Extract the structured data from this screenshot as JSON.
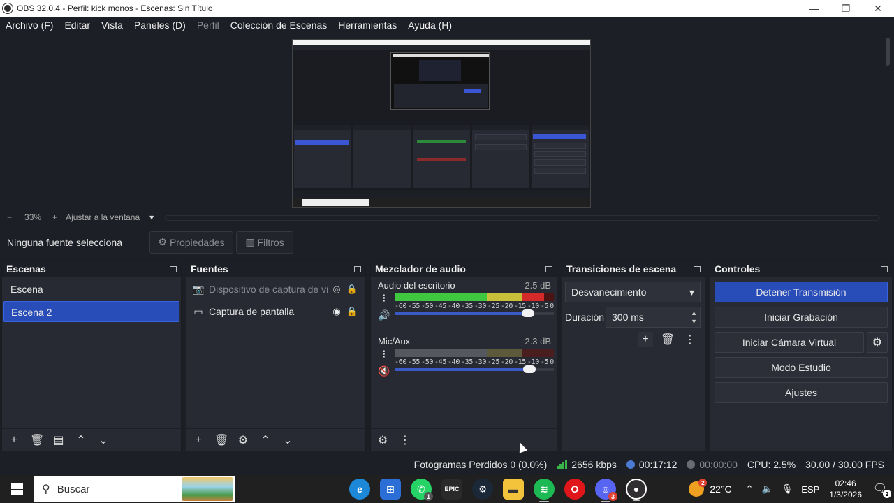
{
  "window": {
    "title": "OBS 32.0.4 - Perfil: kick monos - Escenas: Sin Título",
    "minimize": "—",
    "restore": "❐",
    "close": "✕"
  },
  "menu": [
    {
      "label": "Archivo (F)",
      "enabled": true
    },
    {
      "label": "Editar",
      "enabled": true
    },
    {
      "label": "Vista",
      "enabled": true
    },
    {
      "label": "Paneles (D)",
      "enabled": true
    },
    {
      "label": "Perfil",
      "enabled": false
    },
    {
      "label": "Colección de Escenas",
      "enabled": true
    },
    {
      "label": "Herramientas",
      "enabled": true
    },
    {
      "label": "Ayuda (H)",
      "enabled": true
    }
  ],
  "zoom": {
    "minus": "−",
    "value": "33%",
    "plus": "+",
    "fit_label": "Ajustar a la ventana",
    "dropdown": "▾"
  },
  "context": {
    "no_source": "Ninguna fuente selecciona",
    "properties": "Propiedades",
    "filters": "Filtros"
  },
  "scenes": {
    "title": "Escenas",
    "items": [
      {
        "label": "Escena",
        "selected": false
      },
      {
        "label": "Escena 2",
        "selected": true
      }
    ]
  },
  "sources": {
    "title": "Fuentes",
    "items": [
      {
        "label": "Dispositivo de captura de vi",
        "icon": "camera-icon",
        "visible": false,
        "locked": true
      },
      {
        "label": "Captura de pantalla",
        "icon": "monitor-icon",
        "visible": true,
        "locked": true
      }
    ]
  },
  "mixer": {
    "title": "Mezclador de audio",
    "ticks": [
      "-60",
      "-55",
      "-50",
      "-45",
      "-40",
      "-35",
      "-30",
      "-25",
      "-20",
      "-15",
      "-10",
      "-5",
      "0"
    ],
    "channels": [
      {
        "name": "Audio del escritorio",
        "db": "-2.5 dB",
        "muted": false,
        "volume_fraction": 0.9
      },
      {
        "name": "Mic/Aux",
        "db": "-2.3 dB",
        "muted": true,
        "volume_fraction": 0.91
      }
    ]
  },
  "transitions": {
    "title": "Transiciones de escena",
    "selected": "Desvanecimiento",
    "duration_label": "Duración",
    "duration_value": "300 ms"
  },
  "controls": {
    "title": "Controles",
    "stop_stream": "Detener Transmisión",
    "start_recording": "Iniciar Grabación",
    "start_virtual_cam": "Iniciar Cámara Virtual",
    "studio_mode": "Modo Estudio",
    "settings": "Ajustes"
  },
  "status": {
    "dropped_frames": "Fotogramas Perdidos 0 (0.0%)",
    "bitrate": "2656 kbps",
    "stream_time": "00:17:12",
    "record_time": "00:00:00",
    "cpu": "CPU: 2.5%",
    "fps": "30.00 / 30.00 FPS"
  },
  "taskbar": {
    "search_placeholder": "Buscar",
    "temperature": "22°C",
    "weather_badge": "2",
    "language": "ESP",
    "time": "02:46",
    "date": "1/3/2026",
    "notification_count": "2",
    "whatsapp_badge": "1",
    "discord_badge": "3",
    "epic_label": "EPIC",
    "colors": {
      "edge": "#1e88d8",
      "store": "#2b6fd6",
      "whatsapp": "#25d366",
      "steam": "#1b2838",
      "files": "#f3c33c",
      "spotify": "#1db954",
      "opera": "#e0161b",
      "discord": "#5865f2",
      "obs": "#302e31"
    }
  },
  "colors": {
    "accent": "#284cb8",
    "panel_bg": "#272a33",
    "app_bg": "#1d1f26"
  }
}
